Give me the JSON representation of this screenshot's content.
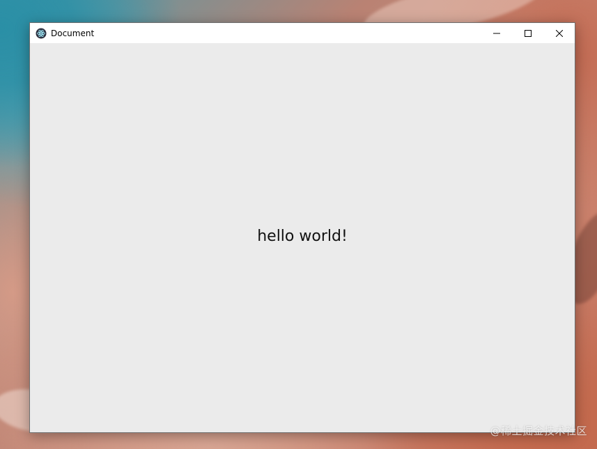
{
  "window": {
    "title": "Document",
    "app_icon": "electron-icon",
    "controls": {
      "minimize": "minimize-icon",
      "maximize": "maximize-icon",
      "close": "close-icon"
    }
  },
  "content": {
    "text": "hello world!",
    "background": "#ebebeb"
  },
  "watermark": {
    "text": "@稀土掘金技术社区"
  }
}
